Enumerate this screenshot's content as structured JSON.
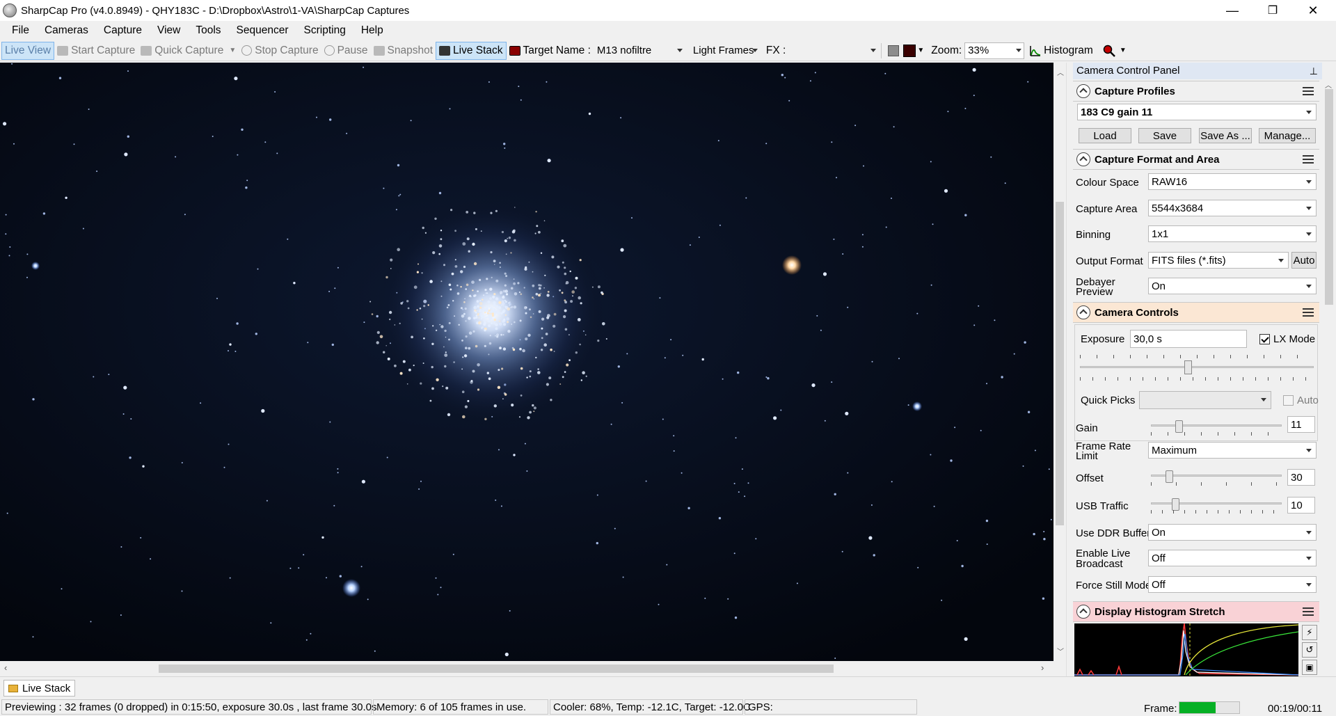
{
  "window": {
    "title": "SharpCap Pro (v4.0.8949) - QHY183C - D:\\Dropbox\\Astro\\1-VA\\SharpCap Captures",
    "minimize": "—",
    "maximize": "❐",
    "close": "✕"
  },
  "menu": [
    "File",
    "Cameras",
    "Capture",
    "View",
    "Tools",
    "Sequencer",
    "Scripting",
    "Help"
  ],
  "toolbar": {
    "live_view": "Live View",
    "start_capture": "Start Capture",
    "quick_capture": "Quick Capture",
    "stop_capture": "Stop Capture",
    "pause": "Pause",
    "snapshot": "Snapshot",
    "live_stack": "Live Stack",
    "target_name_label": "Target Name :",
    "target_name_value": "M13 nofiltre",
    "frame_type": "Light Frames",
    "fx_label": "FX :",
    "fx_value": "",
    "zoom_label": "Zoom:",
    "zoom_value": "33%",
    "histogram": "Histogram"
  },
  "panel": {
    "title": "Camera Control Panel",
    "capture_profiles": {
      "title": "Capture Profiles",
      "selected": "183 C9 gain 11",
      "load": "Load",
      "save": "Save",
      "save_as": "Save As ...",
      "manage": "Manage..."
    },
    "format": {
      "title": "Capture Format and Area",
      "colour_space_label": "Colour Space",
      "colour_space": "RAW16",
      "capture_area_label": "Capture Area",
      "capture_area": "5544x3684",
      "binning_label": "Binning",
      "binning": "1x1",
      "output_format_label": "Output Format",
      "output_format": "FITS files (*.fits)",
      "auto": "Auto",
      "debayer_label_1": "Debayer",
      "debayer_label_2": "Preview",
      "debayer": "On"
    },
    "controls": {
      "title": "Camera Controls",
      "exposure_label": "Exposure",
      "exposure": "30,0 s",
      "lx_mode": "LX Mode",
      "lx_mode_checked": true,
      "quick_picks_label": "Quick Picks",
      "quick_picks": "",
      "auto": "Auto",
      "gain_label": "Gain",
      "gain": "11",
      "gain_fraction": 0.2,
      "frame_rate_label_1": "Frame Rate",
      "frame_rate_label_2": "Limit",
      "frame_rate": "Maximum",
      "offset_label": "Offset",
      "offset": "30",
      "offset_fraction": 0.12,
      "usb_label": "USB Traffic",
      "usb": "10",
      "usb_fraction": 0.17,
      "ddr_label": "Use DDR Buffer",
      "ddr": "On",
      "broadcast_label_1": "Enable Live",
      "broadcast_label_2": "Broadcast",
      "broadcast": "Off",
      "force_still_label": "Force Still Mode",
      "force_still": "Off"
    },
    "histogram": {
      "title": "Display Histogram Stretch"
    }
  },
  "bottom": {
    "tab": "Live Stack"
  },
  "status": {
    "preview": "Previewing : 32 frames (0 dropped) in 0:15:50, exposure 30.0s , last frame 30.0s",
    "memory": "Memory: 6 of 105 frames in use.",
    "cooler": "Cooler: 68%, Temp: -12.1C, Target: -12.0C",
    "gps": "GPS:",
    "frame_label": "Frame:",
    "frame_progress": 0.6,
    "time": "00:19/00:11"
  },
  "colors": {
    "accent_active": "#cce4f7",
    "histogram_header": "#f9d2d6",
    "controls_header": "#fbe7d4",
    "progress": "#06b025"
  }
}
